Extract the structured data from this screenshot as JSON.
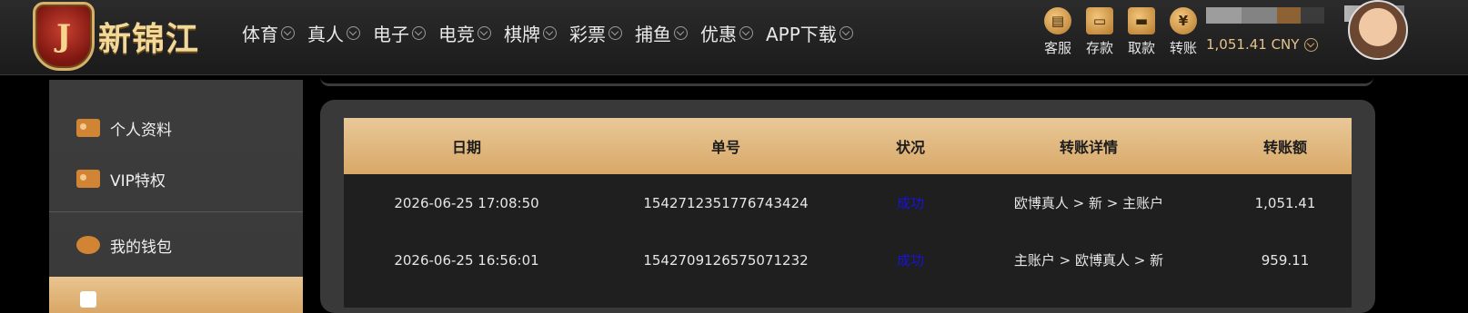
{
  "brand": {
    "logo_letter": "J",
    "name": "新锦江"
  },
  "nav": {
    "items": [
      {
        "label": "体育"
      },
      {
        "label": "真人"
      },
      {
        "label": "电子"
      },
      {
        "label": "电竞"
      },
      {
        "label": "棋牌"
      },
      {
        "label": "彩票"
      },
      {
        "label": "捕鱼"
      },
      {
        "label": "优惠"
      },
      {
        "label": "APP下载"
      }
    ]
  },
  "actions": [
    {
      "label": "客服",
      "icon": "chat-icon",
      "glyph": "▤"
    },
    {
      "label": "存款",
      "icon": "wallet-icon",
      "glyph": "▭"
    },
    {
      "label": "取款",
      "icon": "cash-icon",
      "glyph": "▬"
    },
    {
      "label": "转账",
      "icon": "yuan-coin-icon",
      "glyph": "¥"
    }
  ],
  "user": {
    "balance": "1,051.41 CNY"
  },
  "sidebar": {
    "items": [
      {
        "label": "个人资料",
        "icon": "id-card-icon"
      },
      {
        "label": "VIP特权",
        "icon": "vip-card-icon"
      },
      {
        "label": "我的钱包",
        "icon": "piggy-bank-icon"
      }
    ]
  },
  "table": {
    "headers": [
      "日期",
      "单号",
      "状况",
      "转账详情",
      "转账额"
    ],
    "rows": [
      {
        "date": "2026-06-25 17:08:50",
        "order": "1542712351776743424",
        "status": "成功",
        "detail": "欧博真人 > 新 > 主账户",
        "amount": "1,051.41"
      },
      {
        "date": "2026-06-25 16:56:01",
        "order": "1542709126575071232",
        "status": "成功",
        "detail": "主账户 > 欧博真人 > 新",
        "amount": "959.11"
      }
    ]
  },
  "colors": {
    "accent_gold": "#d8a867",
    "status_success": "#1a12d6"
  }
}
